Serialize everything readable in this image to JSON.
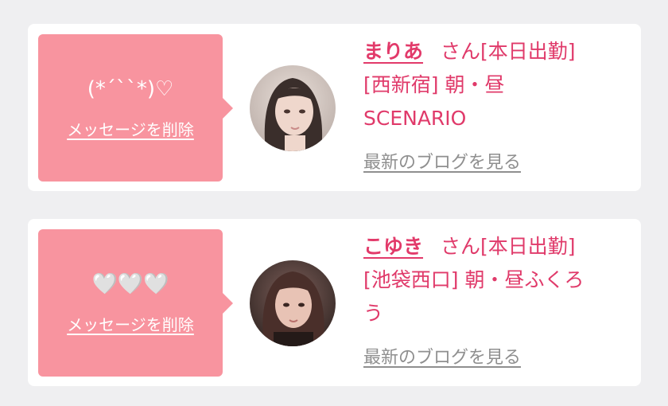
{
  "colors": {
    "bubble": "#f8949f",
    "accent": "#e03a6a",
    "muted": "#8f8f8f",
    "background": "#efeff1"
  },
  "cards": [
    {
      "message": "(*´``*)♡",
      "delete_label": "メッセージを削除",
      "avatar_icon": "avatar-photo",
      "name": "まりあ",
      "line1_rest": "さん[本日出勤]",
      "line2": "[西新宿] 朝・昼",
      "line3": "SCENARIO",
      "blog_label": "最新のブログを見る"
    },
    {
      "message": "🤍🤍🤍",
      "delete_label": "メッセージを削除",
      "avatar_icon": "avatar-photo",
      "name": "こゆき",
      "line1_rest": "さん[本日出勤]",
      "line2": "[池袋西口] 朝・昼ふくろ",
      "line3": "う",
      "blog_label": "最新のブログを見る"
    }
  ]
}
